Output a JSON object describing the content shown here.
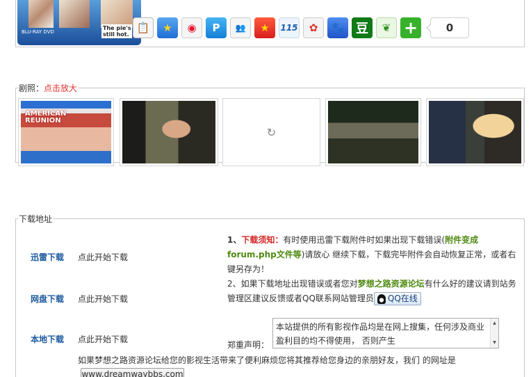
{
  "poster": {
    "brand_line": "BLU-RAY  DVD",
    "tagline_1": "The pie's",
    "tagline_2": "still hot."
  },
  "share": {
    "icons": [
      {
        "name": "copy-link-icon",
        "glyph": "📋"
      },
      {
        "name": "qzone-icon",
        "glyph": "★"
      },
      {
        "name": "sina-weibo-icon",
        "glyph": "◉"
      },
      {
        "name": "pengyou-icon",
        "glyph": "P"
      },
      {
        "name": "renren-icon",
        "glyph": "👥"
      },
      {
        "name": "kaixin-icon",
        "glyph": "★"
      },
      {
        "name": "115-icon",
        "glyph": "115"
      },
      {
        "name": "tencent-weibo-icon",
        "glyph": "✿"
      },
      {
        "name": "baidu-icon",
        "glyph": "🐾"
      },
      {
        "name": "douban-icon",
        "glyph": "豆"
      },
      {
        "name": "fanfou-icon",
        "glyph": "❦"
      },
      {
        "name": "more-share-icon",
        "glyph": "+"
      }
    ],
    "count": "0"
  },
  "screenshots": {
    "legend_prefix": "剧照：",
    "legend_zoom": "点击放大",
    "reload_glyph": "↻"
  },
  "download": {
    "legend": "下载地址",
    "rows": [
      {
        "label": "迅雷下载",
        "link": "点此开始下载"
      },
      {
        "label": "网盘下载",
        "link": "点此开始下载"
      },
      {
        "label": "本地下载",
        "link": "点此开始下载"
      }
    ],
    "notes": {
      "n1_index": "1、",
      "n1_title": "下载须知：",
      "n1_text_a": "有时使用迅雷下载附件时如果出现下载错误(",
      "n1_highlight": "附件变成forum.php文件等",
      "n1_text_b": ")请放心 继续下载，下载完毕附件会自动恢复正常，或者右键另存为！",
      "n2_text_a": "2、如果下载地址出现错误或者您对",
      "n2_highlight": "梦想之路资源论坛",
      "n2_text_b": "有什么好的建议请到站务管理区建议反馈或者QQ联系网站管理员",
      "qq_label": "QQ在线"
    },
    "declaration_label": "郑重声明：",
    "declaration_text": "本站提供的所有影视作品均是在网上搜集，任何涉及商业盈利目的均不得使用， 否则产生",
    "recommend_text": "如果梦想之路资源论坛给您的影视生活带来了便利麻烦您将其推荐给您身边的亲朋好友，我们 的网址是",
    "site_url": "www.dreamwaybbs.com"
  }
}
